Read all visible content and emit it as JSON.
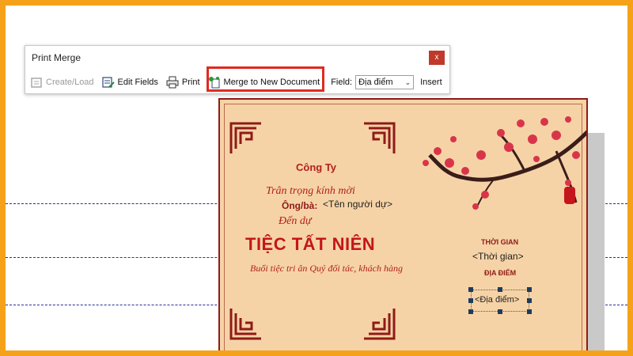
{
  "dialog": {
    "title": "Print Merge",
    "close_glyph": "x",
    "toolbar": {
      "create_load": "Create/Load",
      "edit_fields": "Edit Fields",
      "print": "Print",
      "merge_new_doc": "Merge to New Document",
      "field_label": "Field:",
      "field_value": "Địa điểm",
      "insert": "Insert"
    }
  },
  "card": {
    "company": "Công Ty",
    "invite_line": "Trân trọng kính mời",
    "guest_label": "Ông/bà:",
    "guest_field": "<Tên người dự>",
    "attend_line": "Đến dự",
    "event_title": "TIỆC TẤT NIÊN",
    "description": "Buổi tiệc tri ân Quý đối tác, khách hàng",
    "time_label": "THỜI GIAN",
    "time_field": "<Thời gian>",
    "place_label": "ĐỊA ĐIỂM",
    "place_field": "<Địa điểm>"
  },
  "colors": {
    "frame": "#f5a21a",
    "card_bg": "#f6d3a6",
    "card_border": "#8e1b18",
    "title_red": "#c4161c",
    "highlight": "#e02a1f"
  }
}
